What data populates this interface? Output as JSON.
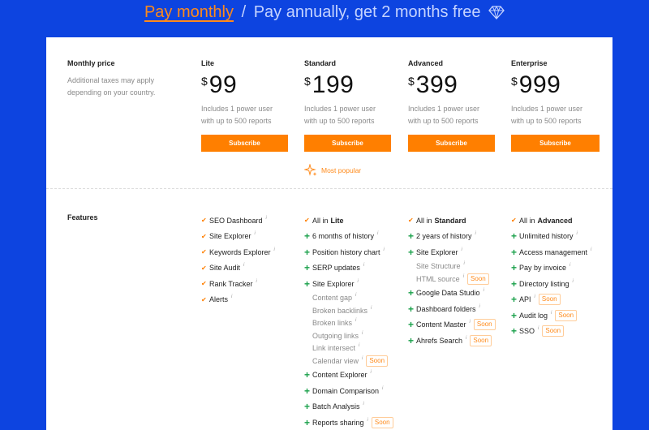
{
  "billing": {
    "monthly": "Pay monthly",
    "separator": "/",
    "annual": "Pay annually, get 2 months free"
  },
  "colors": {
    "background": "#0d44e0",
    "accent": "#ff7f00",
    "plus": "#19a04a"
  },
  "monthly_price": {
    "title": "Monthly price",
    "desc_line1": "Additional taxes may apply",
    "desc_line2": "depending on your country."
  },
  "plans": [
    {
      "name": "Lite",
      "currency": "$",
      "price": "99",
      "inc1": "Includes 1 power user",
      "inc2": "with up to 500 reports",
      "cta": "Subscribe"
    },
    {
      "name": "Standard",
      "currency": "$",
      "price": "199",
      "inc1": "Includes 1 power user",
      "inc2": "with up to 500 reports",
      "cta": "Subscribe",
      "badge": "Most popular"
    },
    {
      "name": "Advanced",
      "currency": "$",
      "price": "399",
      "inc1": "Includes 1 power user",
      "inc2": "with up to 500 reports",
      "cta": "Subscribe"
    },
    {
      "name": "Enterprise",
      "currency": "$",
      "price": "999",
      "inc1": "Includes 1 power user",
      "inc2": "with up to 500 reports",
      "cta": "Subscribe"
    }
  ],
  "features_title": "Features",
  "info_glyph": "i",
  "soon_label": "Soon",
  "features": {
    "lite": [
      {
        "mark": "check",
        "text": "SEO Dashboard"
      },
      {
        "mark": "check",
        "text": "Site Explorer"
      },
      {
        "mark": "check",
        "text": "Keywords Explorer"
      },
      {
        "mark": "check",
        "text": "Site Audit"
      },
      {
        "mark": "check",
        "text": "Rank Tracker"
      },
      {
        "mark": "check",
        "text": "Alerts"
      }
    ],
    "standard": [
      {
        "mark": "check",
        "text": "All in",
        "bold": "Lite",
        "noinfo": true
      },
      {
        "mark": "plus",
        "text": "6 months of history"
      },
      {
        "mark": "plus",
        "text": "Position history chart"
      },
      {
        "mark": "plus",
        "text": "SERP updates"
      },
      {
        "mark": "plus",
        "text": "Site Explorer"
      },
      {
        "mark": "sub",
        "text": "Content gap"
      },
      {
        "mark": "sub",
        "text": "Broken backlinks"
      },
      {
        "mark": "sub",
        "text": "Broken links"
      },
      {
        "mark": "sub",
        "text": "Outgoing links"
      },
      {
        "mark": "sub",
        "text": "Link intersect"
      },
      {
        "mark": "sub",
        "text": "Calendar view",
        "soon": true
      },
      {
        "mark": "plus",
        "text": "Content Explorer"
      },
      {
        "mark": "plus",
        "text": "Domain Comparison"
      },
      {
        "mark": "plus",
        "text": "Batch Analysis"
      },
      {
        "mark": "plus",
        "text": "Reports sharing",
        "soon": true
      }
    ],
    "advanced": [
      {
        "mark": "check",
        "text": "All in",
        "bold": "Standard",
        "noinfo": true
      },
      {
        "mark": "plus",
        "text": "2 years of history"
      },
      {
        "mark": "plus",
        "text": "Site Explorer"
      },
      {
        "mark": "sub",
        "text": "Site Structure"
      },
      {
        "mark": "sub",
        "text": "HTML source",
        "soon": true
      },
      {
        "mark": "plus",
        "text": "Google Data Studio"
      },
      {
        "mark": "plus",
        "text": "Dashboard folders"
      },
      {
        "mark": "plus",
        "text": "Content Master",
        "soon": true
      },
      {
        "mark": "plus",
        "text": "Ahrefs Search",
        "soon": true
      }
    ],
    "enterprise": [
      {
        "mark": "check",
        "text": "All in",
        "bold": "Advanced",
        "noinfo": true
      },
      {
        "mark": "plus",
        "text": "Unlimited history"
      },
      {
        "mark": "plus",
        "text": "Access management"
      },
      {
        "mark": "plus",
        "text": "Pay by invoice"
      },
      {
        "mark": "plus",
        "text": "Directory listing"
      },
      {
        "mark": "plus",
        "text": "API",
        "soon": true
      },
      {
        "mark": "plus",
        "text": "Audit log",
        "soon": true
      },
      {
        "mark": "plus",
        "text": "SSO",
        "soon": true
      }
    ]
  }
}
